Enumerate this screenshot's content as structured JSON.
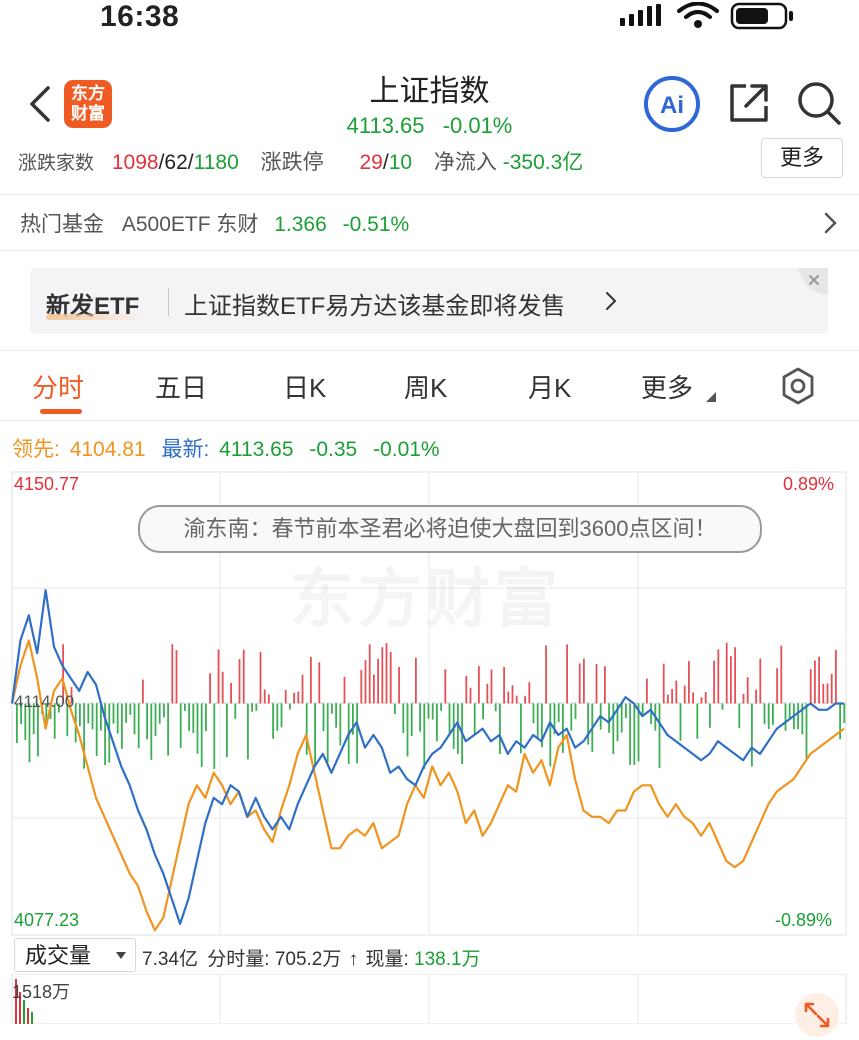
{
  "status": {
    "time": "16:38"
  },
  "nav": {
    "logo_line1": "东方",
    "logo_line2": "财富",
    "title": "上证指数",
    "price": "4113.65",
    "change_pct": "-0.01%"
  },
  "breadth": {
    "label": "涨跌家数",
    "up": "1098",
    "flat": "62",
    "down": "1180",
    "limit_label": "涨跌停",
    "limit_up": "29",
    "limit_down": "10",
    "netflow_label": "净流入",
    "netflow_value": "-350.3亿",
    "more": "更多"
  },
  "hot_fund": {
    "label": "热门基金",
    "name": "A500ETF 东财",
    "price": "1.366",
    "pct": "-0.51%"
  },
  "banner": {
    "tag": "新发ETF",
    "text": "上证指数ETF易方达该基金即将发售"
  },
  "tabs": [
    "分时",
    "五日",
    "日K",
    "周K",
    "月K",
    "更多"
  ],
  "active_tab": 0,
  "quote": {
    "lead_label": "领先:",
    "lead_value": "4104.81",
    "latest_label": "最新:",
    "latest_value": "4113.65",
    "change": "-0.35",
    "change_pct": "-0.01%"
  },
  "chart_labels": {
    "y_top": "4150.77",
    "y_mid": "4114.00",
    "y_bottom": "4077.23",
    "pct_top": "0.89%",
    "pct_bottom": "-0.89%"
  },
  "comment": {
    "text": "渝东南：春节前本圣君必将迫使大盘回到3600点区间！"
  },
  "watermark": "东方财富",
  "volume": {
    "selector": "成交量",
    "total": "7.34亿",
    "minute_label": "分时量:",
    "minute_value": "705.2万",
    "current_label": "现量:",
    "current_value": "138.1万",
    "axis_max": "1518万"
  },
  "colors": {
    "up": "#e0323a",
    "down": "#1aa035",
    "price_line": "#2f6fc5",
    "avg_line": "#f0941e",
    "accent": "#f05a23"
  },
  "chart_data": {
    "type": "line",
    "title": "",
    "ylim": [
      4077.23,
      4150.77
    ],
    "y_ref": 4114.0,
    "series": [
      {
        "name": "最新",
        "values": [
          4114,
          4124,
          4128,
          4122,
          4132,
          4123,
          4120,
          4118,
          4116,
          4119,
          4117,
          4112,
          4108,
          4104,
          4101,
          4097,
          4094,
          4090,
          4087,
          4083,
          4079,
          4083,
          4089,
          4095,
          4099,
          4098,
          4101,
          4100,
          4096,
          4099,
          4096,
          4094,
          4096,
          4094,
          4098,
          4101,
          4104,
          4106,
          4103,
          4106,
          4109,
          4111,
          4107,
          4109,
          4107,
          4103,
          4104,
          4102,
          4101,
          4104,
          4106,
          4107,
          4109,
          4111,
          4108,
          4109,
          4110,
          4108,
          4109,
          4106,
          4108,
          4107,
          4109,
          4108,
          4111,
          4109,
          4110,
          4107,
          4108,
          4110,
          4112,
          4111,
          4113,
          4115,
          4114,
          4112,
          4113,
          4111,
          4109,
          4108,
          4107,
          4106,
          4105,
          4106,
          4108,
          4107,
          4106,
          4105,
          4107,
          4106,
          4108,
          4110,
          4111,
          4112,
          4113,
          4114,
          4113,
          4113,
          4114,
          4114
        ]
      },
      {
        "name": "领先",
        "values": [
          4114,
          4120,
          4124,
          4118,
          4110,
          4116,
          4118,
          4113,
          4109,
          4104,
          4099,
          4096,
          4093,
          4090,
          4087,
          4085,
          4081,
          4078,
          4080,
          4086,
          4092,
          4098,
          4101,
          4099,
          4103,
          4101,
          4098,
          4100,
          4096,
          4097,
          4094,
          4092,
          4097,
          4101,
          4106,
          4109,
          4103,
          4097,
          4091,
          4091,
          4093,
          4094,
          4093,
          4095,
          4091,
          4092,
          4093,
          4098,
          4101,
          4099,
          4104,
          4101,
          4103,
          4100,
          4095,
          4097,
          4093,
          4095,
          4098,
          4101,
          4100,
          4106,
          4103,
          4105,
          4101,
          4107,
          4109,
          4102,
          4097,
          4096,
          4096,
          4095,
          4097,
          4097,
          4100,
          4101,
          4101,
          4098,
          4096,
          4098,
          4096,
          4095,
          4093,
          4095,
          4092,
          4089,
          4088,
          4089,
          4092,
          4095,
          4098,
          4100,
          4101,
          4102,
          4104,
          4106,
          4107,
          4108,
          4109,
          4110
        ]
      }
    ]
  }
}
